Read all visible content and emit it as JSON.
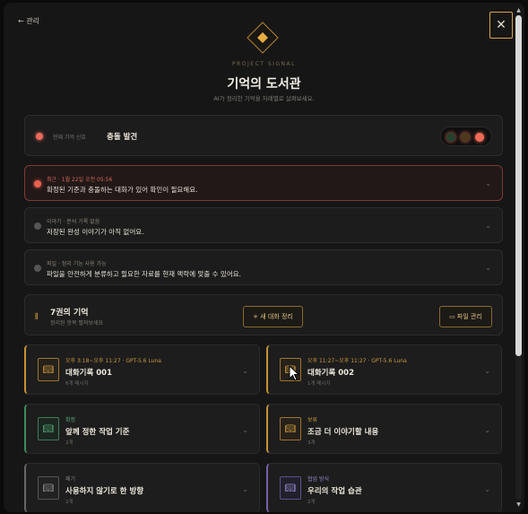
{
  "header": {
    "back_label": "← 관리",
    "close_label": "✕",
    "project_label": "PROJECT SIGNAL",
    "title": "기억의 도서관",
    "subtitle": "AI가 정리한 기억을 차례별로 살펴보세요."
  },
  "status": {
    "caption": "현재 기억 신호",
    "text": "충돌 발견",
    "lights": [
      "green",
      "amber",
      "red"
    ]
  },
  "alerts": [
    {
      "meta": "최근 · 1월 22일 오전 05:56",
      "text": "확정된 기준과 충돌하는 대화가 있어 확인이 필요해요.",
      "level": "red"
    },
    {
      "meta": "이야기 · 분석 기록 없음",
      "text": "저장된 완성 이야기가 아직 없어요.",
      "level": "grey"
    },
    {
      "meta": "파일 · 정리 기능 사용 가능",
      "text": "파일을 안전하게 분류하고 필요한 자료를 현재 맥락에 맞출 수 있어요.",
      "level": "grey"
    }
  ],
  "memory": {
    "title": "7권의 기억",
    "subtitle": "정리된 항목 펼쳐보세요",
    "new_chat_label": "+ 새 대화 정리",
    "file_label": "▭ 파일 관리"
  },
  "tiles": [
    {
      "meta": "오후 3:18~오후 11:27 · GPT-5.6 Luna",
      "title": "대화기록 001",
      "sub": "6개 메시지",
      "icon": "book-icon",
      "accent": "#c69236"
    },
    {
      "meta": "오후 11:27~오후 11:27 · GPT-5.6 Luna",
      "title": "대화기록 002",
      "sub": "1개 메시지",
      "icon": "book-icon",
      "accent": "#c69236"
    },
    {
      "meta": "확정",
      "title": "앞께 정한 작업 기준",
      "sub": "2개",
      "icon": "book-icon",
      "accent": "#3f8a5e"
    },
    {
      "meta": "보류",
      "title": "조금 더 이야기할 내용",
      "sub": "3개",
      "icon": "book-icon",
      "accent": "#c69236"
    },
    {
      "meta": "폐기",
      "title": "사용하지 않기로 한 방향",
      "sub": "2개",
      "icon": "book-icon",
      "accent": "#666666"
    },
    {
      "meta": "협업 방식",
      "title": "우리의 작업 습관",
      "sub": "2개",
      "icon": "book-icon",
      "accent": "#7661a8"
    }
  ],
  "colors": {
    "gold": "#d9a441",
    "alert_red": "#e8604f",
    "background": "#161616"
  }
}
